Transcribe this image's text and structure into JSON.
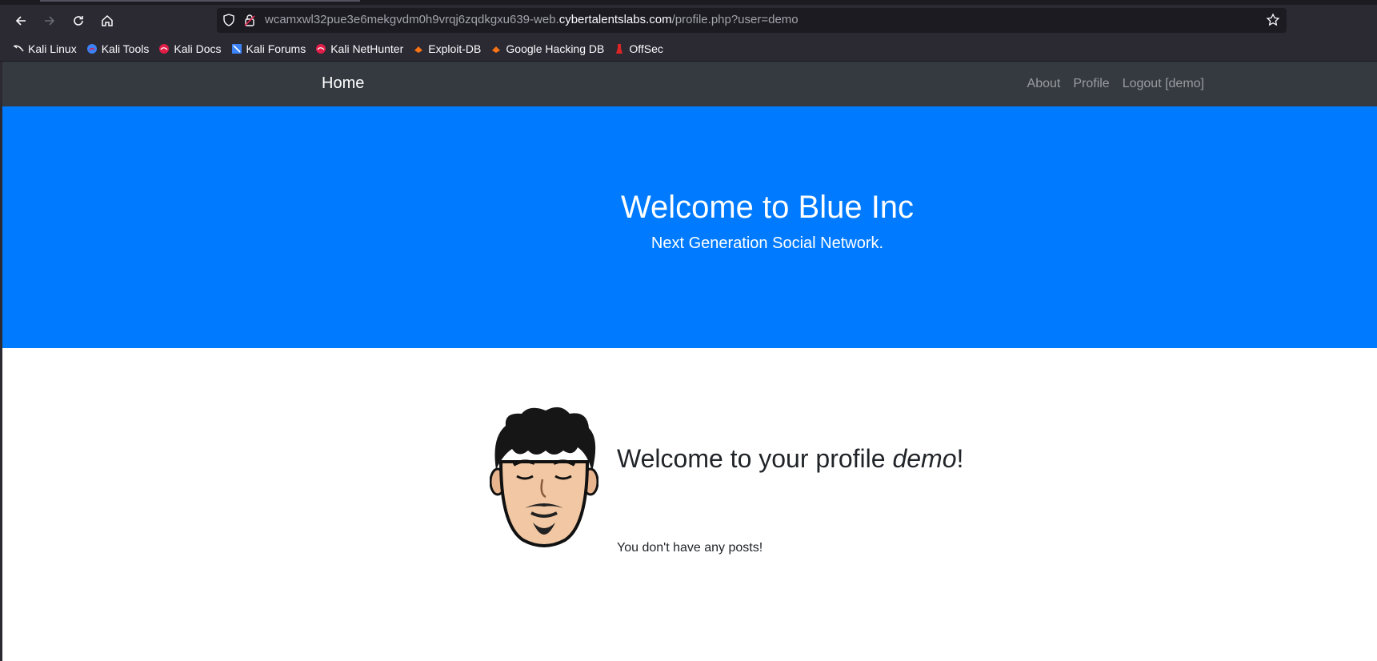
{
  "browser": {
    "url_prefix": "wcamxwl32pue3e6mekgvdm0h9vrqj6zqdkgxu639-web.",
    "url_host": "cybertalentslabs.com",
    "url_path": "/profile.php?user=demo",
    "bookmarks": [
      {
        "label": "Kali Linux",
        "icon": "kali-dragon-icon",
        "color": "#ffffff"
      },
      {
        "label": "Kali Tools",
        "icon": "kali-tools-icon",
        "color": "#3b82f6"
      },
      {
        "label": "Kali Docs",
        "icon": "kali-docs-icon",
        "color": "#e11d48"
      },
      {
        "label": "Kali Forums",
        "icon": "kali-forums-icon",
        "color": "#3b82f6"
      },
      {
        "label": "Kali NetHunter",
        "icon": "kali-nethunter-icon",
        "color": "#e11d48"
      },
      {
        "label": "Exploit-DB",
        "icon": "exploit-db-icon",
        "color": "#f97316"
      },
      {
        "label": "Google Hacking DB",
        "icon": "ghdb-icon",
        "color": "#f97316"
      },
      {
        "label": "OffSec",
        "icon": "offsec-icon",
        "color": "#dc2626"
      }
    ]
  },
  "navbar": {
    "brand": "Home",
    "links": [
      "About",
      "Profile",
      "Logout [demo]"
    ]
  },
  "hero": {
    "title": "Welcome to Blue Inc",
    "subtitle": "Next Generation Social Network.",
    "color": "#007bff"
  },
  "profile": {
    "welcome_prefix": "Welcome to your profile ",
    "username": "demo",
    "welcome_suffix": "!",
    "posts_message": "You don't have any posts!"
  }
}
